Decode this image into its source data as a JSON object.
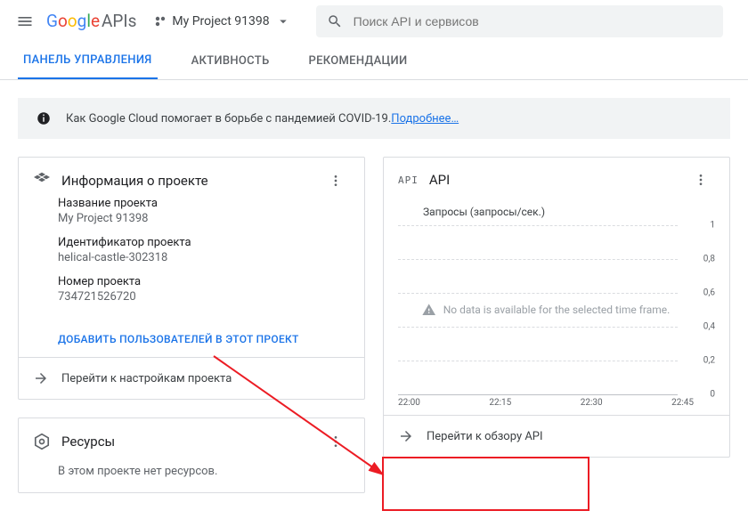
{
  "header": {
    "logo_apis": "APIs",
    "project_name": "My Project 91398",
    "search_placeholder": "Поиск API и сервисов"
  },
  "tabs": {
    "dashboard": "ПАНЕЛЬ УПРАВЛЕНИЯ",
    "activity": "АКТИВНОСТЬ",
    "recommendations": "РЕКОМЕНДАЦИИ"
  },
  "banner": {
    "text": "Как Google Cloud помогает в борьбе с пандемией COVID-19. ",
    "link": "Подробнее…"
  },
  "project_info": {
    "title": "Информация о проекте",
    "name_label": "Название проекта",
    "name_value": "My Project 91398",
    "id_label": "Идентификатор проекта",
    "id_value": "helical-castle-302318",
    "number_label": "Номер проекта",
    "number_value": "734721526720",
    "add_users": "ДОБАВИТЬ ПОЛЬЗОВАТЕЛЕЙ В ЭТОТ ПРОЕКТ",
    "go_settings": "Перейти к настройкам проекта"
  },
  "resources": {
    "title": "Ресурсы",
    "empty": "В этом проекте нет ресурсов."
  },
  "api": {
    "prefix": "API",
    "title": "API",
    "chart_title": "Запросы (запросы/сек.)",
    "no_data": "No data is available for the selected time frame.",
    "go_overview": "Перейти к обзору API"
  },
  "chart_data": {
    "type": "line",
    "title": "Запросы (запросы/сек.)",
    "xlabel": "",
    "ylabel": "",
    "ylim": [
      0,
      1
    ],
    "y_ticks": [
      "1",
      "0,8",
      "0,6",
      "0,4",
      "0,2",
      "0"
    ],
    "x_ticks": [
      "22:00",
      "22:15",
      "22:30",
      "22:45"
    ],
    "series": [],
    "no_data_message": "No data is available for the selected time frame."
  }
}
